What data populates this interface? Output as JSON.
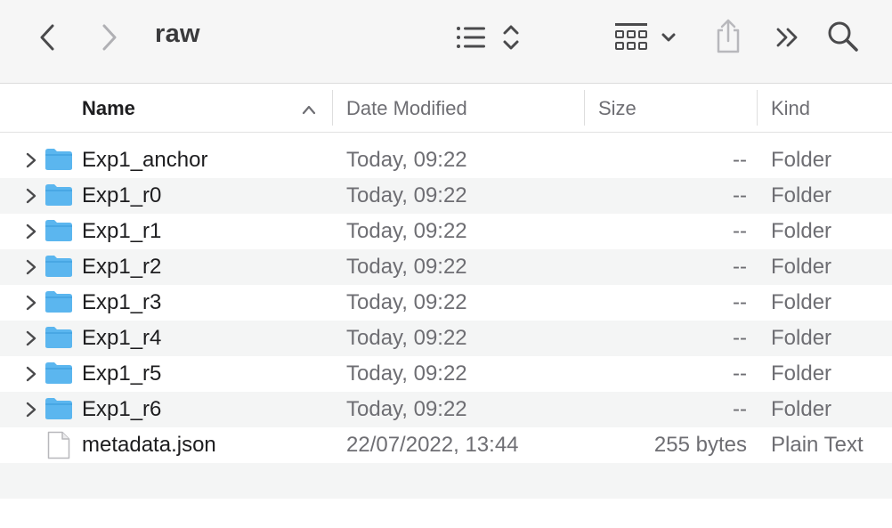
{
  "window": {
    "title": "raw"
  },
  "toolbar": {
    "back_icon": "chevron-left-icon",
    "forward_icon": "chevron-right-icon",
    "list_view_icon": "list-view-icon",
    "sort_icon": "up-down-chevron-icon",
    "group_icon": "grid-group-icon",
    "dropdown_icon": "chevron-down-icon",
    "share_icon": "share-icon",
    "more_icon": "double-chevron-right-icon",
    "search_icon": "search-icon"
  },
  "columns": {
    "name": "Name",
    "date": "Date Modified",
    "size": "Size",
    "kind": "Kind",
    "sort_indicator": "chevron-up-icon"
  },
  "files": [
    {
      "name": "Exp1_anchor",
      "date": "Today, 09:22",
      "size": "--",
      "kind": "Folder",
      "type": "folder"
    },
    {
      "name": "Exp1_r0",
      "date": "Today, 09:22",
      "size": "--",
      "kind": "Folder",
      "type": "folder"
    },
    {
      "name": "Exp1_r1",
      "date": "Today, 09:22",
      "size": "--",
      "kind": "Folder",
      "type": "folder"
    },
    {
      "name": "Exp1_r2",
      "date": "Today, 09:22",
      "size": "--",
      "kind": "Folder",
      "type": "folder"
    },
    {
      "name": "Exp1_r3",
      "date": "Today, 09:22",
      "size": "--",
      "kind": "Folder",
      "type": "folder"
    },
    {
      "name": "Exp1_r4",
      "date": "Today, 09:22",
      "size": "--",
      "kind": "Folder",
      "type": "folder"
    },
    {
      "name": "Exp1_r5",
      "date": "Today, 09:22",
      "size": "--",
      "kind": "Folder",
      "type": "folder"
    },
    {
      "name": "Exp1_r6",
      "date": "Today, 09:22",
      "size": "--",
      "kind": "Folder",
      "type": "folder"
    },
    {
      "name": "metadata.json",
      "date": "22/07/2022, 13:44",
      "size": "255 bytes",
      "kind": "Plain Text",
      "type": "file"
    }
  ],
  "colors": {
    "folder": "#5bb6ef",
    "alt_row": "#f4f5f5",
    "toolbar_bg": "#f6f6f6"
  }
}
